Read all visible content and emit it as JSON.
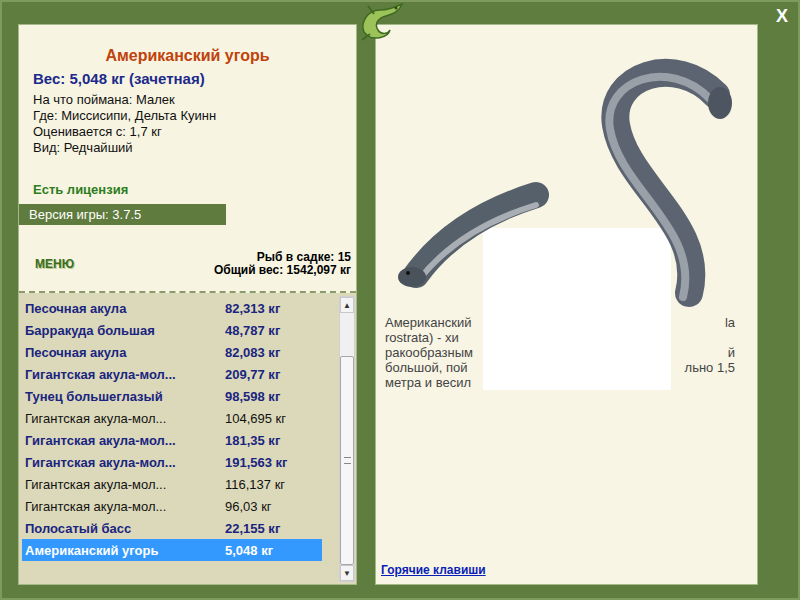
{
  "window": {
    "close": "X"
  },
  "fish": {
    "title": "Американский угорь",
    "weight": "Вес: 5,048 кг (зачетная)",
    "details": [
      "На что поймана: Малек",
      "Где: Миссисипи, Дельта Куинн",
      "Оценивается с: 1,7 кг",
      "Вид: Редчайший"
    ]
  },
  "license": "Есть лицензия",
  "version": "Версия игры: 3.7.5",
  "menu": "МЕНЮ",
  "keepnet": {
    "count": "Рыб в садке: 15",
    "total": "Общий вес: 1542,097 кг"
  },
  "catch_list": [
    {
      "name": "Песочная акула",
      "weight": "82,313 кг",
      "trophy": true,
      "selected": false
    },
    {
      "name": "Барракуда большая",
      "weight": "48,787 кг",
      "trophy": true,
      "selected": false
    },
    {
      "name": "Песочная акула",
      "weight": "82,083 кг",
      "trophy": true,
      "selected": false
    },
    {
      "name": "Гигантская акула-мол...",
      "weight": "209,77 кг",
      "trophy": true,
      "selected": false
    },
    {
      "name": "Тунец большеглазый",
      "weight": "98,598 кг",
      "trophy": true,
      "selected": false
    },
    {
      "name": "Гигантская акула-мол...",
      "weight": "104,695 кг",
      "trophy": false,
      "selected": false
    },
    {
      "name": "Гигантская акула-мол...",
      "weight": "181,35 кг",
      "trophy": true,
      "selected": false
    },
    {
      "name": "Гигантская акула-мол...",
      "weight": "191,563 кг",
      "trophy": true,
      "selected": false
    },
    {
      "name": "Гигантская акула-мол...",
      "weight": "116,137 кг",
      "trophy": false,
      "selected": false
    },
    {
      "name": "Гигантская акула-мол...",
      "weight": "96,03 кг",
      "trophy": false,
      "selected": false
    },
    {
      "name": "Полосатый басс",
      "weight": "22,155 кг",
      "trophy": true,
      "selected": false
    },
    {
      "name": "Американский угорь",
      "weight": "5,048 кг",
      "trophy": true,
      "selected": true
    }
  ],
  "scrollbar": {
    "up": "▲",
    "down": "▼",
    "level": 1,
    "thumb": 0.83
  },
  "description": [
    {
      "left": "Американский",
      "right": "la"
    },
    {
      "left": "rostrata) - хи",
      "right": ""
    },
    {
      "left": "ракообразным",
      "right": "й"
    },
    {
      "left": "большой, пой",
      "right": "льно 1,5"
    },
    {
      "left": "метра и весил",
      "right": ""
    }
  ],
  "hotkeys": "Горячие клавиши"
}
